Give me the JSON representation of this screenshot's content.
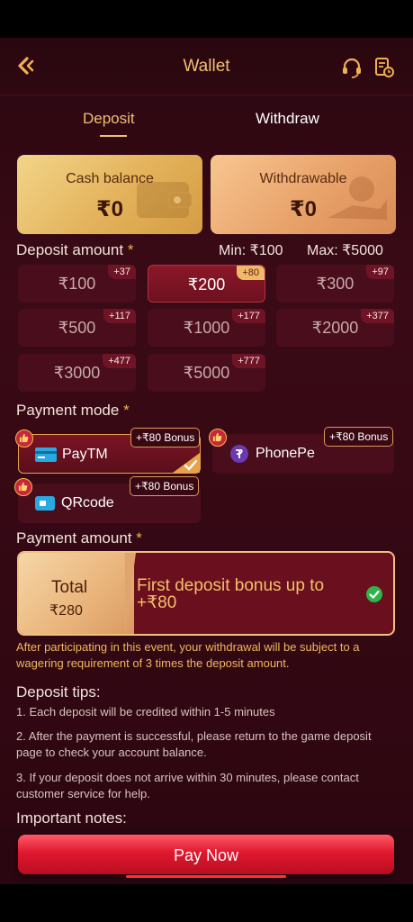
{
  "header": {
    "title": "Wallet",
    "back_icon": "chevron-left-icon",
    "support_icon": "headset-icon",
    "record_icon": "history-icon"
  },
  "tabs": [
    {
      "label": "Deposit",
      "active": true
    },
    {
      "label": "Withdraw",
      "active": false
    }
  ],
  "balances": {
    "cash": {
      "label": "Cash balance",
      "value": "₹0"
    },
    "withdrawable": {
      "label": "Withdrawable",
      "value": "₹0"
    }
  },
  "deposit_amount": {
    "label": "Deposit amount",
    "required_mark": "*",
    "min": "Min: ₹100",
    "max": "Max: ₹5000",
    "options": [
      {
        "amount": "₹100",
        "bonus": "+37",
        "selected": false
      },
      {
        "amount": "₹200",
        "bonus": "+80",
        "selected": true
      },
      {
        "amount": "₹300",
        "bonus": "+97",
        "selected": false
      },
      {
        "amount": "₹500",
        "bonus": "+117",
        "selected": false
      },
      {
        "amount": "₹1000",
        "bonus": "+177",
        "selected": false
      },
      {
        "amount": "₹2000",
        "bonus": "+377",
        "selected": false
      },
      {
        "amount": "₹3000",
        "bonus": "+477",
        "selected": false
      },
      {
        "amount": "₹5000",
        "bonus": "+777",
        "selected": false
      }
    ]
  },
  "payment_mode": {
    "label": "Payment mode",
    "required_mark": "*",
    "methods": [
      {
        "name": "PayTM",
        "bonus": "+₹80 Bonus",
        "selected": true
      },
      {
        "name": "PhonePe",
        "bonus": "+₹80 Bonus",
        "selected": false
      },
      {
        "name": "QRcode",
        "bonus": "+₹80 Bonus",
        "selected": false
      }
    ]
  },
  "payment_amount": {
    "label": "Payment amount",
    "required_mark": "*",
    "total_label": "Total",
    "total_value": "₹280",
    "promo_line1": "First deposit bonus up to",
    "promo_line2": "+₹80"
  },
  "notice": "After participating in this event, your withdrawal will be subject to a wagering requirement of 3 times the deposit amount.",
  "tips": {
    "title": "Deposit tips:",
    "items": [
      "1. Each deposit will be credited within 1-5 minutes",
      "2. After the payment is successful, please return to the game deposit page to check your account balance.",
      "3. If your deposit does not arrive within 30 minutes, please contact customer service for help."
    ]
  },
  "notes_title": "Important notes:",
  "pay_button": "Pay Now",
  "colors": {
    "gold": "#f0c070",
    "background": "#3a0a16",
    "button_red": "#e0182e"
  }
}
